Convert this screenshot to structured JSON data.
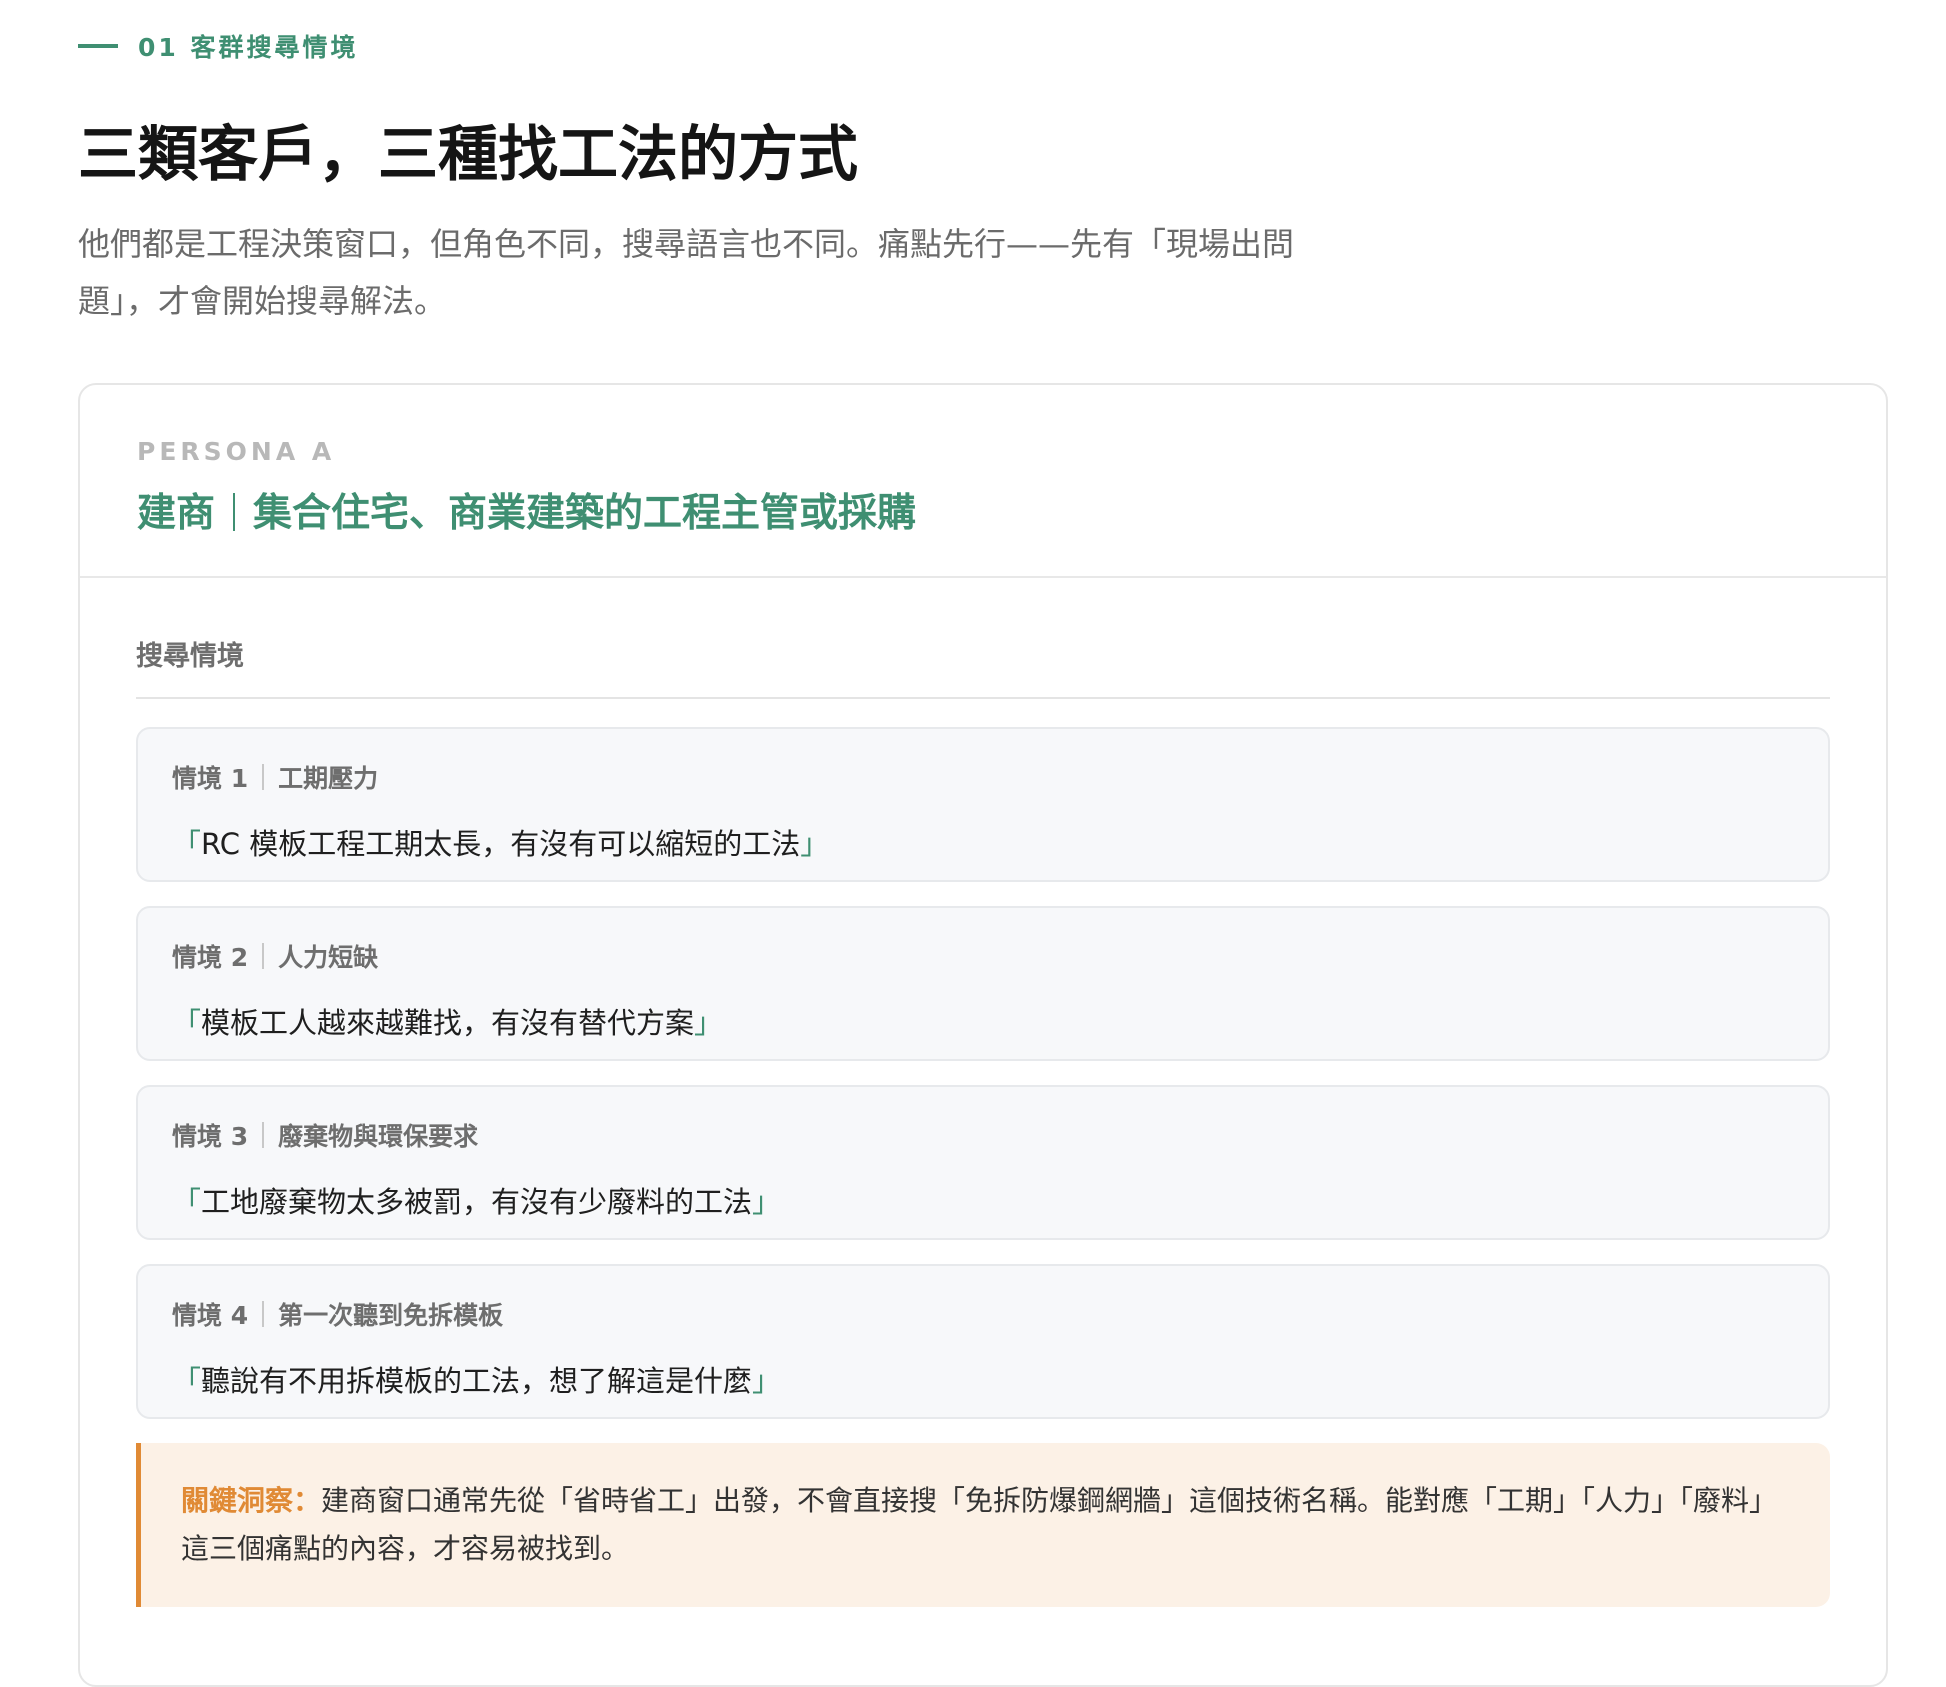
{
  "header": {
    "eyebrow": "01 客群搜尋情境",
    "title": "三類客戶，三種找工法的方式",
    "lede": "他們都是工程決策窗口，但角色不同，搜尋語言也不同。痛點先行——先有「現場出問題」，才會開始搜尋解法。"
  },
  "persona": {
    "tag": "PERSONA A",
    "role": "建商",
    "description": "集合住宅、商業建築的工程主管或採購",
    "section_label": "搜尋情境",
    "scenarios": [
      {
        "number": "情境 1",
        "topic": "工期壓力",
        "open": "「",
        "quote": "RC 模板工程工期太長，有沒有可以縮短的工法",
        "close": "」"
      },
      {
        "number": "情境 2",
        "topic": "人力短缺",
        "open": "「",
        "quote": "模板工人越來越難找，有沒有替代方案",
        "close": "」"
      },
      {
        "number": "情境 3",
        "topic": "廢棄物與環保要求",
        "open": "「",
        "quote": "工地廢棄物太多被罰，有沒有少廢料的工法",
        "close": "」"
      },
      {
        "number": "情境 4",
        "topic": "第一次聽到免拆模板",
        "open": "「",
        "quote": "聽說有不用拆模板的工法，想了解這是什麼",
        "close": "」"
      }
    ],
    "insight": {
      "key": "關鍵洞察：",
      "text": "建商窗口通常先從「省時省工」出發，不會直接搜「免拆防爆鋼網牆」這個技術名稱。能對應「工期」「人力」「廢料」這三個痛點的內容，才容易被找到。"
    }
  },
  "colors": {
    "accent_green": "#3f8f72",
    "accent_orange": "#e08a35",
    "insight_bg": "#fcf1e6"
  }
}
